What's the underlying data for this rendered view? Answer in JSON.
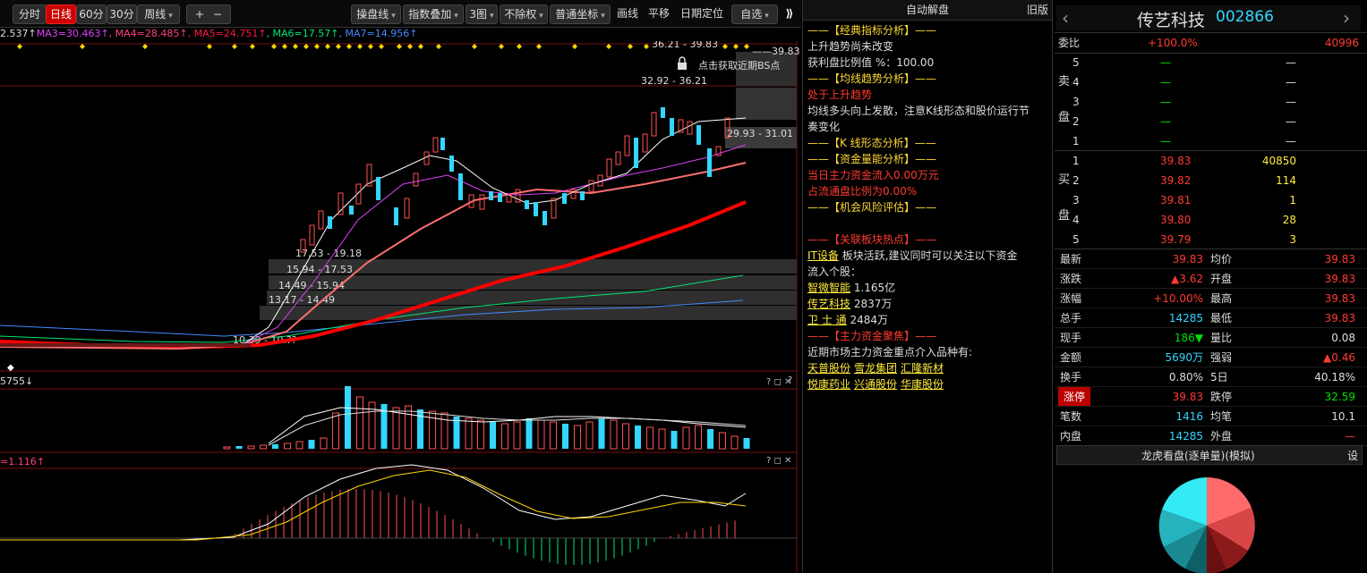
{
  "toolbar": {
    "tabs": [
      "分时",
      "日线",
      "60分",
      "30分",
      "周线"
    ],
    "active_tab": "日线",
    "plus": "+",
    "minus": "−",
    "tools": [
      "操盘线",
      "指数叠加",
      "3图",
      "不除权",
      "普通坐标",
      "画线",
      "平移",
      "日期定位",
      "自选"
    ]
  },
  "ma_line": {
    "ma2": "2.537↑",
    "ma3": "MA3=30.463↑",
    "ma4": "MA4=28.485↑",
    "ma5": "MA5=24.751↑",
    "ma6": "MA6=17.57↑",
    "ma7": "MA7=14.956↑"
  },
  "chart_labels": {
    "price_top": "39.83",
    "top_range": "36.21 - 39.83",
    "bs_tip": "点击获取近期BS点",
    "range1": "32.92 - 36.21",
    "range2": "29.93 - 31.01",
    "range3": "17.53 - 19.18",
    "range4": "15.94 - 17.53",
    "range5": "14.49 - 15.94",
    "range6": "13.17 - 14.49",
    "range7": "10.39 - 10.??",
    "vol_label": "5755↓",
    "macd_label": "=1.116↑",
    "panel_ctrl": "? ◻ ✕"
  },
  "mid": {
    "title": "自动解盘",
    "old_version": "旧版",
    "lines": [
      {
        "t": "——【经典指标分析】——",
        "c": "sec"
      },
      {
        "t": "上升趋势尚未改变",
        "c": "white"
      },
      {
        "t": "获利盘比例值 %：100.00",
        "c": "white"
      },
      {
        "t": "——【均线趋势分析】——",
        "c": "sec"
      },
      {
        "t": "处于上升趋势",
        "c": "red"
      },
      {
        "t": "均线多头向上发散，注意K线形态和股价运行节",
        "c": "white"
      },
      {
        "t": "奏变化",
        "c": "white"
      },
      {
        "t": "——【K 线形态分析】——",
        "c": "sec"
      },
      {
        "t": "——【资金量能分析】——",
        "c": "sec"
      },
      {
        "t": "当日主力资金流入0.00万元",
        "c": "red"
      },
      {
        "t": "占流通盘比例为0.00%",
        "c": "red"
      },
      {
        "t": "——【机会风险评估】——",
        "c": "sec"
      },
      {
        "t": "",
        "c": "white"
      },
      {
        "t": "——【关联板块热点】——",
        "c": "red"
      }
    ],
    "sector_link": "IT设备",
    "sector_text": " 板块活跃,建议同时可以关注以下资金",
    "sector_text2": "流入个股：",
    "stocks": [
      {
        "name": "智微智能",
        "val": "1.165亿"
      },
      {
        "name": "传艺科技",
        "val": "2837万"
      },
      {
        "name": "卫 士 通",
        "val": "2484万"
      }
    ],
    "fund_title": "——【主力资金聚焦】——",
    "fund_text": "近期市场主力资金重点介入品种有:",
    "fund_links": [
      "天普股份",
      "雪龙集团",
      "汇隆新材",
      "悦康药业",
      "兴通股份",
      "华康股份"
    ]
  },
  "right": {
    "stock_name": "传艺科技",
    "stock_code": "002866",
    "weibi_label": "委比",
    "weibi_val": "+100.0%",
    "weibi_num": "40996",
    "sell_label": [
      "卖",
      "盘"
    ],
    "buy_label": [
      "买",
      "盘"
    ],
    "sells": [
      {
        "n": "5",
        "p": "—",
        "v": "—"
      },
      {
        "n": "4",
        "p": "—",
        "v": "—"
      },
      {
        "n": "3",
        "p": "—",
        "v": "—"
      },
      {
        "n": "2",
        "p": "—",
        "v": "—"
      },
      {
        "n": "1",
        "p": "—",
        "v": "—"
      }
    ],
    "buys": [
      {
        "n": "1",
        "p": "39.83",
        "v": "40850"
      },
      {
        "n": "2",
        "p": "39.82",
        "v": "114"
      },
      {
        "n": "3",
        "p": "39.81",
        "v": "1"
      },
      {
        "n": "4",
        "p": "39.80",
        "v": "28"
      },
      {
        "n": "5",
        "p": "39.79",
        "v": "3"
      }
    ],
    "quotes": [
      {
        "l1": "最新",
        "v1": "39.83",
        "c1": "red",
        "l2": "均价",
        "v2": "39.83",
        "c2": "red"
      },
      {
        "l1": "涨跌",
        "v1": "▲3.62",
        "c1": "red",
        "l2": "开盘",
        "v2": "39.83",
        "c2": "red"
      },
      {
        "l1": "涨幅",
        "v1": "+10.00%",
        "c1": "red",
        "l2": "最高",
        "v2": "39.83",
        "c2": "red"
      },
      {
        "l1": "总手",
        "v1": "14285",
        "c1": "cyan",
        "l2": "最低",
        "v2": "39.83",
        "c2": "red"
      },
      {
        "l1": "现手",
        "v1": "186▼",
        "c1": "green",
        "l2": "量比",
        "v2": "0.08",
        "c2": "white"
      },
      {
        "l1": "金额",
        "v1": "5690万",
        "c1": "cyan",
        "l2": "强弱",
        "v2": "▲0.46",
        "c2": "red"
      },
      {
        "l1": "换手",
        "v1": "0.80%",
        "c1": "white",
        "l2": "5日",
        "v2": "40.18%",
        "c2": "white"
      },
      {
        "l1": "涨停",
        "v1": "39.83",
        "c1": "red",
        "l2": "跌停",
        "v2": "32.59",
        "c2": "green"
      },
      {
        "l1": "笔数",
        "v1": "1416",
        "c1": "cyan",
        "l2": "均笔",
        "v2": "10.1",
        "c2": "white"
      },
      {
        "l1": "内盘",
        "v1": "14285",
        "c1": "cyan",
        "l2": "外盘",
        "v2": "—",
        "c2": "red"
      }
    ],
    "dragon_title": "龙虎看盘(逐单量)(模拟)",
    "dragon_btn": "设",
    "colors": {
      "red": "#ff3b30",
      "cyan": "#33d6ff",
      "green": "#00e000"
    }
  }
}
